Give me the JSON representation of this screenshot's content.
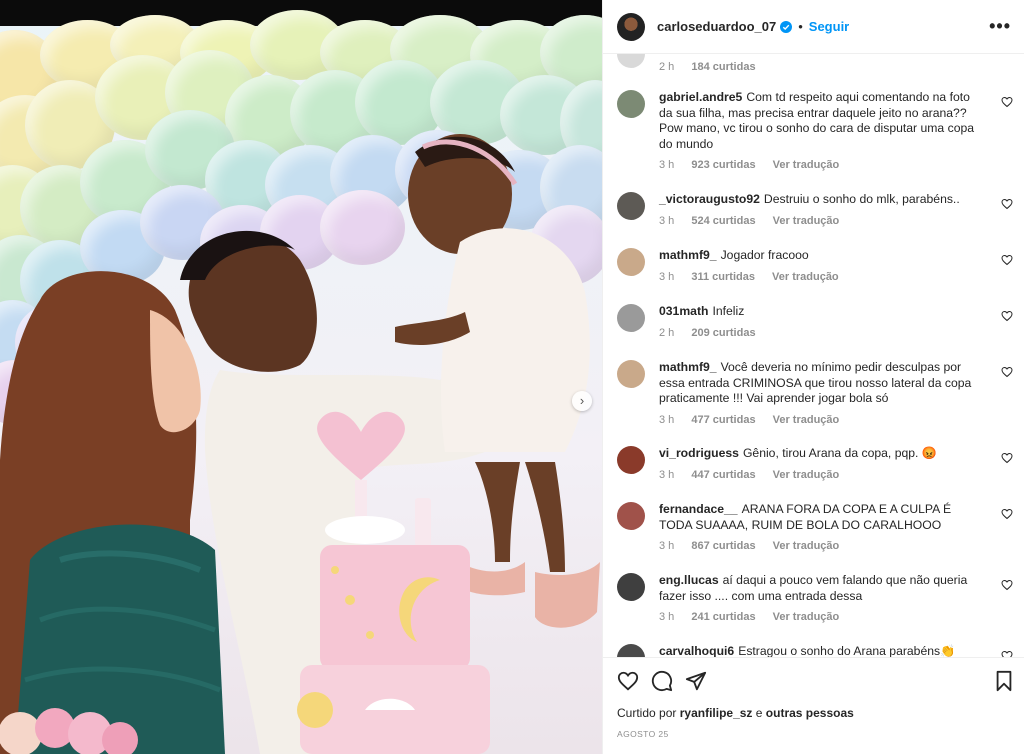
{
  "post": {
    "username": "carloseduardoo_07",
    "separator": "•",
    "follow_label": "Seguir",
    "more_label": "•••",
    "next_label": "›"
  },
  "comments": [
    {
      "username": "",
      "text": "",
      "time": "2 h",
      "likes": "184 curtidas",
      "translate": "",
      "avatar_color": "#d0d0d0"
    },
    {
      "username": "gabriel.andre5",
      "text": "Com td respeito aqui comentando na foto da sua filha, mas precisa entrar daquele jeito no arana?? Pow mano, vc tirou o sonho do cara de disputar uma copa do mundo",
      "time": "3 h",
      "likes": "923 curtidas",
      "translate": "Ver tradução",
      "avatar_color": "#7c8a74"
    },
    {
      "username": "_victoraugusto92",
      "text": "Destruiu o sonho do mlk, parabéns..",
      "time": "3 h",
      "likes": "524 curtidas",
      "translate": "Ver tradução",
      "avatar_color": "#5d5a55"
    },
    {
      "username": "mathmf9_",
      "text": "Jogador fracooo",
      "time": "3 h",
      "likes": "311 curtidas",
      "translate": "Ver tradução",
      "avatar_color": "#c9a98a"
    },
    {
      "username": "031math",
      "text": "Infeliz",
      "time": "2 h",
      "likes": "209 curtidas",
      "translate": "",
      "avatar_color": "#9a9a9a"
    },
    {
      "username": "mathmf9_",
      "text": "Você deveria no mínimo pedir desculpas por essa entrada CRIMINOSA que tirou nosso lateral da copa praticamente !!! Vai aprender jogar bola só",
      "time": "3 h",
      "likes": "477 curtidas",
      "translate": "Ver tradução",
      "avatar_color": "#c9a98a"
    },
    {
      "username": "vi_rodriguess",
      "text": "Gênio, tirou Arana da copa, pqp. 😡",
      "time": "3 h",
      "likes": "447 curtidas",
      "translate": "Ver tradução",
      "avatar_color": "#8a3a2a"
    },
    {
      "username": "fernandace__",
      "text": "ARANA FORA DA COPA E A CULPA É TODA SUAAAA, RUIM DE BOLA DO CARALHOOO",
      "time": "3 h",
      "likes": "867 curtidas",
      "translate": "Ver tradução",
      "avatar_color": "#a0524a"
    },
    {
      "username": "eng.llucas",
      "text": "aí daqui a pouco vem falando que não queria fazer isso .... com uma entrada dessa",
      "time": "3 h",
      "likes": "241 curtidas",
      "translate": "Ver tradução",
      "avatar_color": "#3f3f3f"
    },
    {
      "username": "carvalhoqui6",
      "text": "Estragou o sonho do Arana parabéns👏",
      "time": "",
      "likes": "",
      "translate": "",
      "avatar_color": "#4a4a4a"
    }
  ],
  "footer": {
    "liked_prefix": "Curtido por",
    "liked_user": "ryanfilipe_sz",
    "liked_and": "e",
    "liked_others": "outras pessoas",
    "date": "AGOSTO 25"
  },
  "icons": {
    "like": "heart-icon",
    "comment": "comment-icon",
    "share": "share-icon",
    "save": "bookmark-icon",
    "verified": "verified-badge-icon",
    "comment_like": "heart-icon"
  },
  "colors": {
    "accent": "#0095f6",
    "text": "#262626",
    "muted": "#8e8e8e"
  }
}
